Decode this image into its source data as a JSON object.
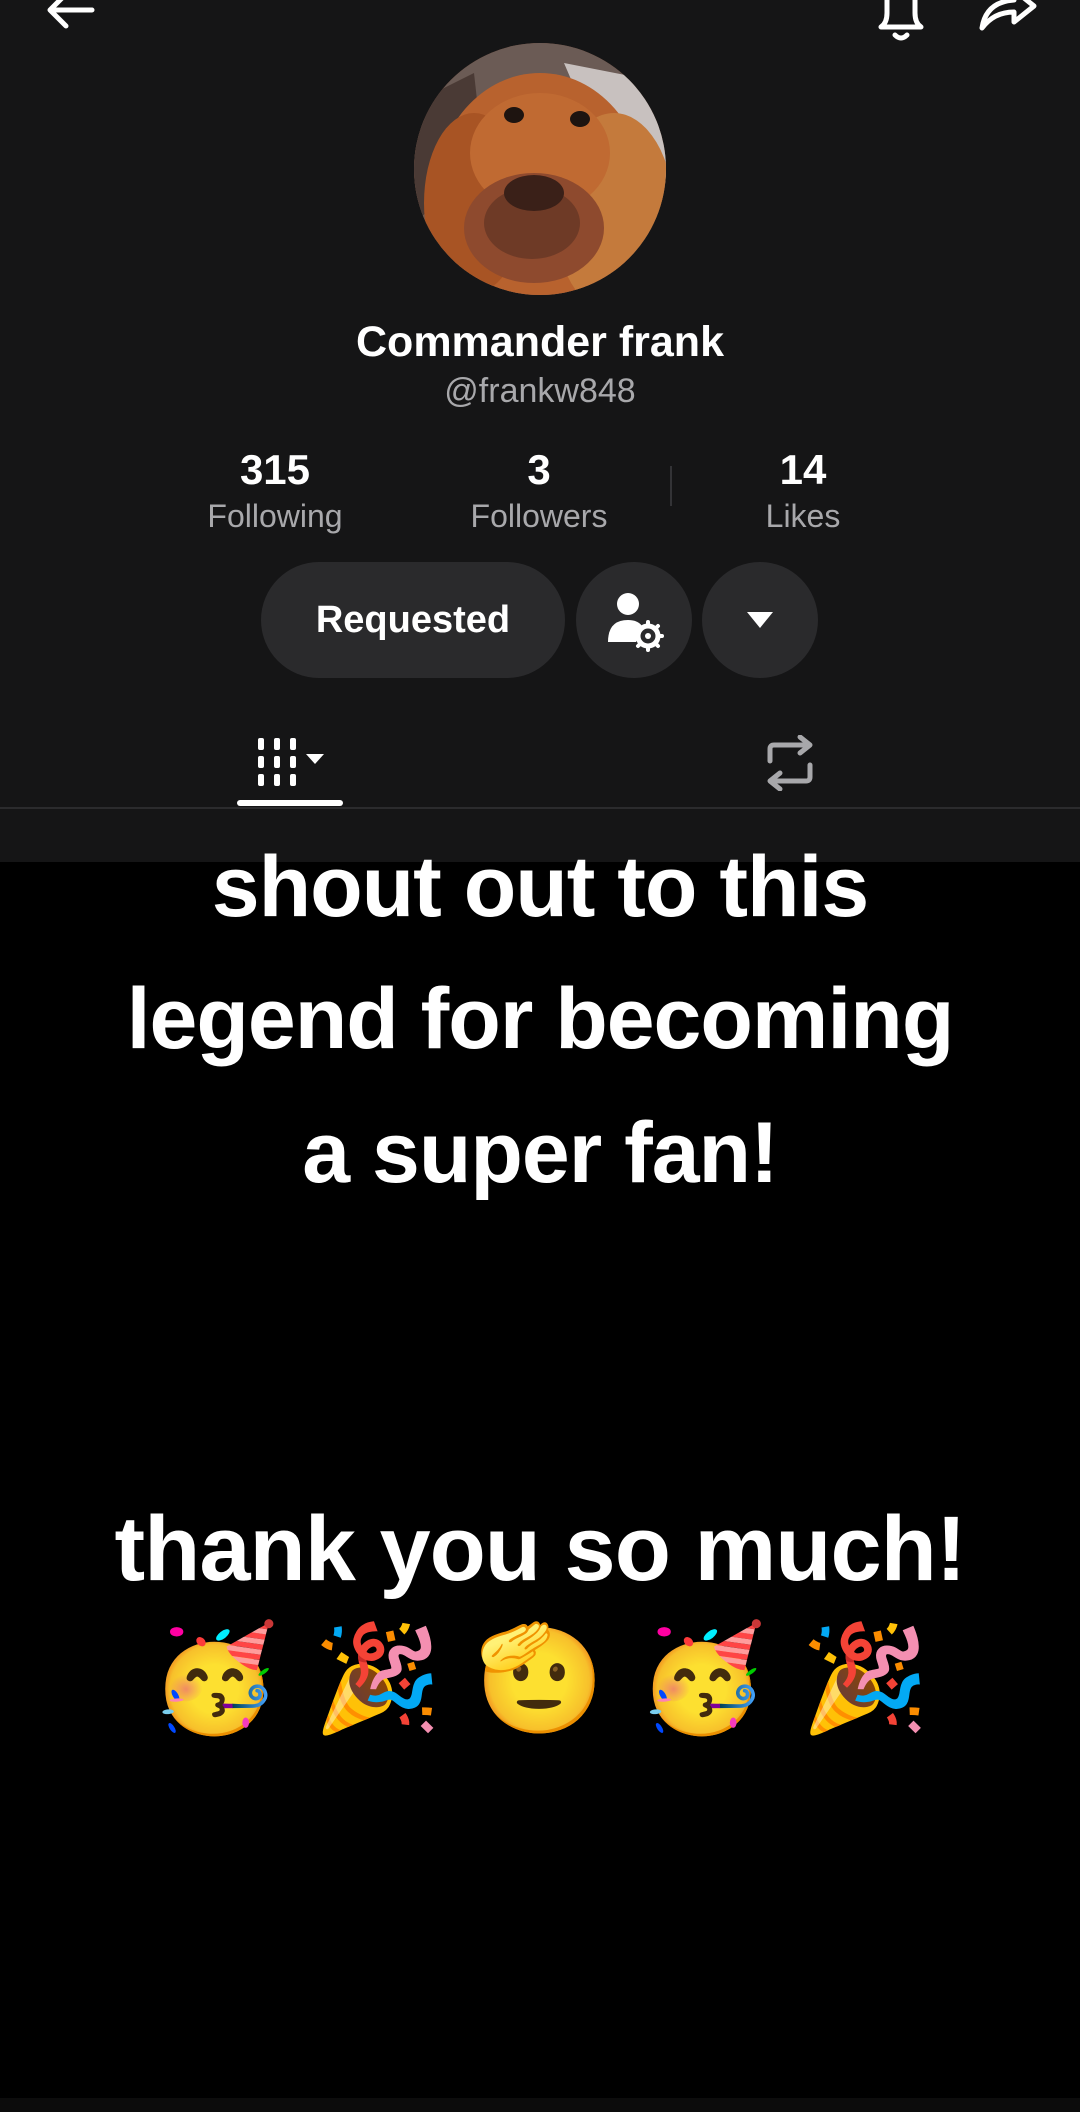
{
  "header": {
    "back_icon": "arrow-left-icon",
    "bell_icon": "bell-icon",
    "share_icon": "share-arrow-icon"
  },
  "profile": {
    "avatar": "dog-avatar",
    "display_name": "Commander frank",
    "handle": "@frankw848",
    "stats": {
      "following": {
        "value": "315",
        "label": "Following"
      },
      "followers": {
        "value": "3",
        "label": "Followers"
      },
      "likes": {
        "value": "14",
        "label": "Likes"
      }
    },
    "actions": {
      "requested_label": "Requested",
      "manage_icon": "person-gear-icon",
      "more_icon": "caret-down-icon"
    },
    "tabs": [
      {
        "icon": "grid-dropdown-icon",
        "active": true
      },
      {
        "icon": "repost-icon",
        "active": false
      }
    ]
  },
  "caption": {
    "line1": "shout out to this",
    "line2": "legend for becoming",
    "line3": "a super fan!",
    "thanks": "thank you so much!",
    "emojis": "🥳 🎉 🫡 🥳 🎉"
  },
  "colors": {
    "panel_bg": "#151516",
    "button_bg": "#2a2a2c",
    "muted_text": "#a8a8ab",
    "page_bg": "#000000"
  }
}
